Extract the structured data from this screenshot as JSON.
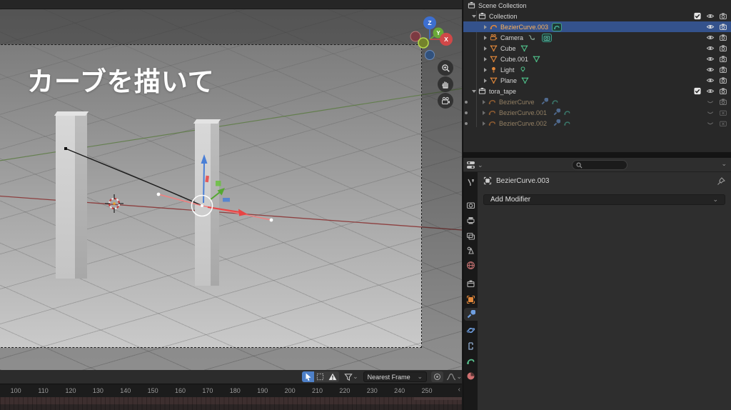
{
  "viewport": {
    "overlay_text": "カーブを描いて",
    "axis_gizmo": {
      "x_label": "X",
      "y_label": "Y",
      "z_label": "Z"
    }
  },
  "outliner": {
    "rows": [
      {
        "label": "Scene Collection"
      },
      {
        "label": "Collection"
      },
      {
        "label": "BezierCurve.003"
      },
      {
        "label": "Camera"
      },
      {
        "label": "Cube"
      },
      {
        "label": "Cube.001"
      },
      {
        "label": "Light"
      },
      {
        "label": "Plane"
      },
      {
        "label": "tora_tape"
      },
      {
        "label": "BezierCurve"
      },
      {
        "label": "BezierCurve.001"
      },
      {
        "label": "BezierCurve.002"
      }
    ],
    "checkmark": "✓"
  },
  "properties": {
    "breadcrumb_object": "BezierCurve.003",
    "add_modifier_label": "Add Modifier",
    "search_placeholder": ""
  },
  "timeline": {
    "snap_mode": "Nearest Frame",
    "ruler_labels": [
      "100",
      "110",
      "120",
      "130",
      "140",
      "150",
      "160",
      "170",
      "180",
      "190",
      "200",
      "210",
      "220",
      "230",
      "240",
      "250"
    ]
  },
  "colors": {
    "selected_row": "#34528c",
    "active_object_text": "#ffb35c",
    "accent_blue": "#4e80c8",
    "object_icon_orange": "#e2883a",
    "data_badge_teal": "#49b8a0",
    "timeline_keys_bg": "#3d2f2f"
  }
}
